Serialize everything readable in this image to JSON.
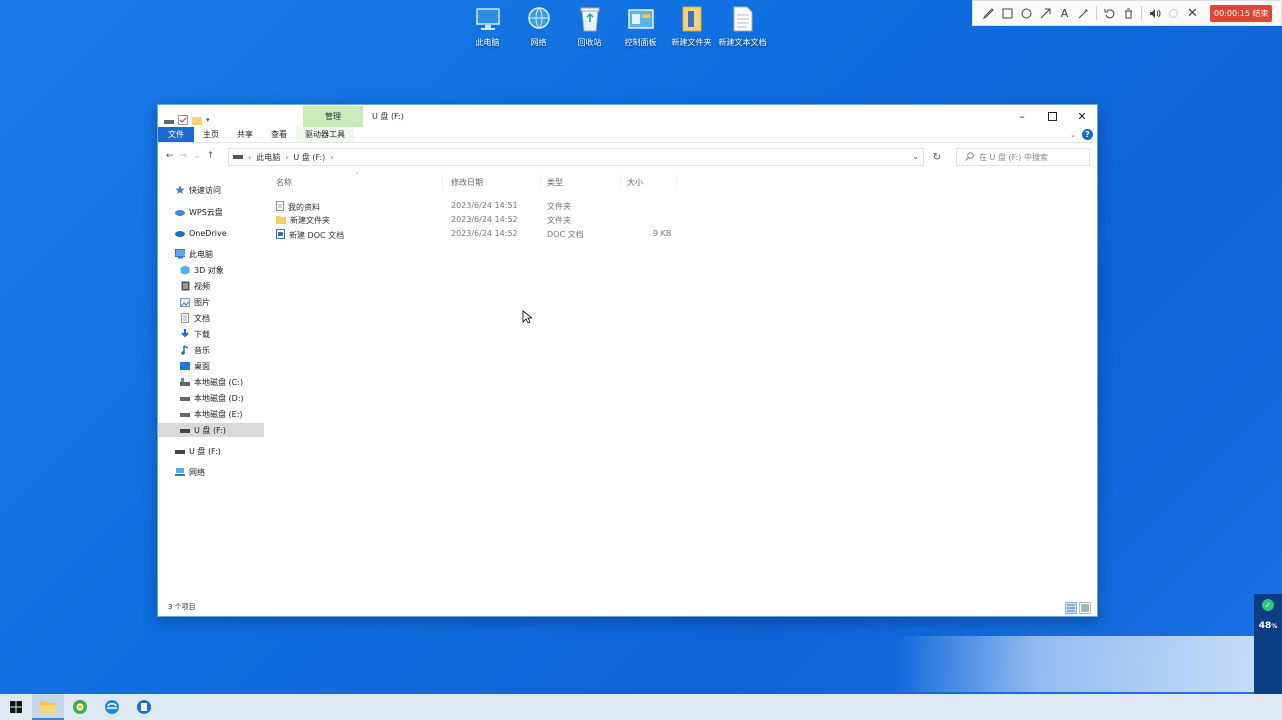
{
  "desktop": {
    "icons": [
      {
        "label": "此电脑",
        "icon": "computer-icon"
      },
      {
        "label": "网络",
        "icon": "network-icon"
      },
      {
        "label": "回收站",
        "icon": "recycle-bin-icon"
      },
      {
        "label": "控制面板",
        "icon": "control-panel-icon"
      },
      {
        "label": "新建文件夹",
        "icon": "folder-icon"
      },
      {
        "label": "新建文本文档",
        "icon": "text-document-icon"
      }
    ]
  },
  "recorder": {
    "time_label": "00:00:15 结束"
  },
  "window": {
    "manage_tab": "管理",
    "title": "U 盘 (F:)",
    "ribbon": {
      "file": "文件",
      "home": "主页",
      "share": "共享",
      "view": "查看",
      "drive_tools": "驱动器工具"
    },
    "address": {
      "root": "此电脑",
      "current": "U 盘 (F:)"
    },
    "search": {
      "placeholder": "在 U 盘 (F:) 中搜索"
    },
    "nav": [
      {
        "label": "快速访问",
        "icon": "star-icon",
        "selected": false
      },
      {
        "label": "WPS云盘",
        "icon": "cloud-icon",
        "selected": false
      },
      {
        "label": "OneDrive",
        "icon": "onedrive-icon",
        "selected": false
      },
      {
        "label": "此电脑",
        "icon": "computer-icon",
        "selected": false
      },
      {
        "label": "3D 对象",
        "icon": "cube-icon",
        "selected": false
      },
      {
        "label": "视频",
        "icon": "video-icon",
        "selected": false
      },
      {
        "label": "图片",
        "icon": "picture-icon",
        "selected": false
      },
      {
        "label": "文档",
        "icon": "document-icon",
        "selected": false
      },
      {
        "label": "下载",
        "icon": "download-icon",
        "selected": false
      },
      {
        "label": "音乐",
        "icon": "music-icon",
        "selected": false
      },
      {
        "label": "桌面",
        "icon": "desktop-icon",
        "selected": false
      },
      {
        "label": "本地磁盘 (C:)",
        "icon": "drive-icon",
        "selected": false
      },
      {
        "label": "本地磁盘 (D:)",
        "icon": "drive-icon",
        "selected": false
      },
      {
        "label": "本地磁盘 (E:)",
        "icon": "drive-icon",
        "selected": false
      },
      {
        "label": "U 盘 (F:)",
        "icon": "usb-drive-icon",
        "selected": true
      },
      {
        "label": "U 盘 (F:)",
        "icon": "usb-drive-icon",
        "selected": false
      },
      {
        "label": "网络",
        "icon": "network-icon",
        "selected": false
      }
    ],
    "columns": {
      "name": "名称",
      "date": "修改日期",
      "type": "类型",
      "size": "大小"
    },
    "files": [
      {
        "name": "我的资料",
        "date": "2023/6/24 14:51",
        "type": "文件夹",
        "size": "",
        "icon": "file-icon"
      },
      {
        "name": "新建文件夹",
        "date": "2023/6/24 14:52",
        "type": "文件夹",
        "size": "",
        "icon": "folder-icon"
      },
      {
        "name": "新建 DOC 文档",
        "date": "2023/6/24 14:52",
        "type": "DOC 文档",
        "size": "9 KB",
        "icon": "doc-icon"
      }
    ],
    "status": "3 个项目"
  },
  "widget": {
    "percent": "48",
    "unit": "%"
  },
  "colors": {
    "accent": "#1a6bd1",
    "manage_tab": "#c9eab9",
    "desktop": "#0f6fe0"
  }
}
